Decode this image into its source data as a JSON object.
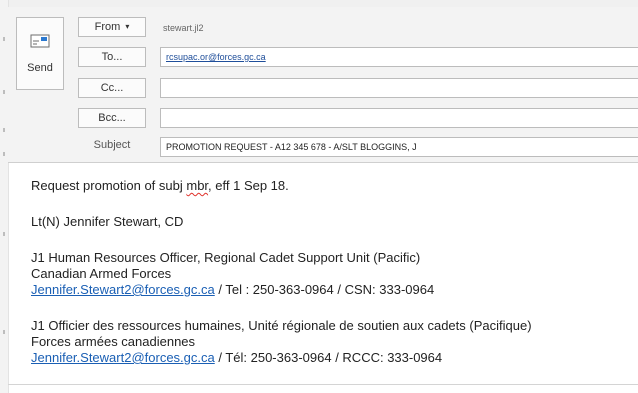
{
  "send": {
    "label": "Send"
  },
  "fields": {
    "from": {
      "button": "From",
      "value": "stewart.jl2"
    },
    "to": {
      "button": "To...",
      "value": "rcsupac.or@forces.gc.ca"
    },
    "cc": {
      "button": "Cc...",
      "value": ""
    },
    "bcc": {
      "button": "Bcc...",
      "value": ""
    },
    "subject": {
      "label": "Subject",
      "value": "PROMOTION REQUEST - A12 345 678 - A/SLT BLOGGINS, J"
    }
  },
  "message": {
    "line1_pre": "Request promotion of subj ",
    "line1_word": "mbr",
    "line1_post": ", eff 1 Sep 18.",
    "signature": "Lt(N) Jennifer Stewart, CD",
    "en_title": "J1 Human Resources Officer, Regional Cadet Support Unit (Pacific)",
    "en_org": "Canadian Armed Forces",
    "en_email": "Jennifer.Stewart2@forces.gc.ca",
    "en_contact": " / Tel : 250-363-0964 / CSN: 333-0964",
    "fr_title": "J1 Officier des ressources humaines, Unité régionale de soutien aux cadets (Pacifique)",
    "fr_org": "Forces armées canadiennes",
    "fr_email": "Jennifer.Stewart2@forces.gc.ca",
    "fr_contact": " / Tél: 250-363-0964 / RCCC: 333-0964"
  },
  "icons": {
    "send": "send-envelope-icon",
    "from_dropdown": "chevron-down-icon"
  }
}
